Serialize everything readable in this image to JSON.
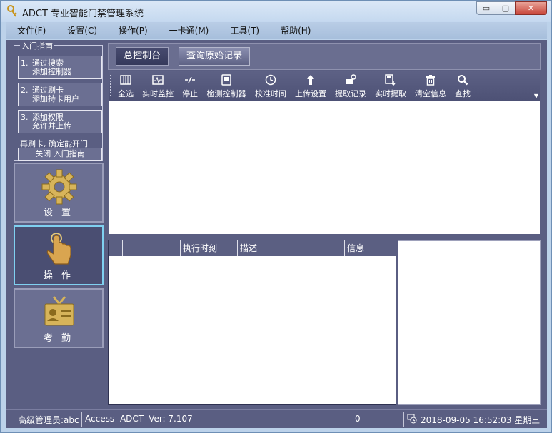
{
  "window": {
    "title": "ADCT 专业智能门禁管理系统"
  },
  "menu": [
    "文件(F)",
    "设置(C)",
    "操作(P)",
    "一卡通(M)",
    "工具(T)",
    "帮助(H)"
  ],
  "guide": {
    "title": "入门指南",
    "steps": [
      {
        "num": "1.",
        "line1": "通过搜索",
        "line2": "添加控制器"
      },
      {
        "num": "2.",
        "line1": "通过刷卡",
        "line2": "添加持卡用户"
      },
      {
        "num": "3.",
        "line1": "添加权限",
        "line2": "允许并上传"
      }
    ],
    "hint": "再刷卡, 确定能开门",
    "close_label": "关闭 入门指南"
  },
  "nav": [
    {
      "label": "设 置",
      "icon": "gear-icon",
      "active": false
    },
    {
      "label": "操 作",
      "icon": "hand-pointer-icon",
      "active": true
    },
    {
      "label": "考 勤",
      "icon": "id-badge-icon",
      "active": false
    }
  ],
  "tabs": [
    "总控制台",
    "查询原始记录"
  ],
  "toolbar": [
    {
      "label": "全选",
      "icon": "select-all-icon"
    },
    {
      "label": "实时监控",
      "icon": "monitor-icon"
    },
    {
      "label": "停止",
      "icon": "stop-icon"
    },
    {
      "label": "检测控制器",
      "icon": "controller-check-icon"
    },
    {
      "label": "校准时间",
      "icon": "clock-icon"
    },
    {
      "label": "上传设置",
      "icon": "upload-icon"
    },
    {
      "label": "提取记录",
      "icon": "extract-icon"
    },
    {
      "label": "实时提取",
      "icon": "realtime-extract-icon"
    },
    {
      "label": "清空信息",
      "icon": "trash-icon"
    },
    {
      "label": "查找",
      "icon": "search-icon"
    }
  ],
  "log_table": {
    "columns": [
      "",
      "",
      "执行时刻",
      "描述",
      "信息"
    ]
  },
  "status": {
    "user": "高级管理员:abc",
    "version": "Access -ADCT- Ver: 7.107",
    "count": "0",
    "datetime": "2018-09-05 16:52:03 星期三"
  },
  "colors": {
    "panel_bg": "#5a5e82",
    "window_frame": "#bcd2ea",
    "active_border": "#7fd0f0"
  }
}
